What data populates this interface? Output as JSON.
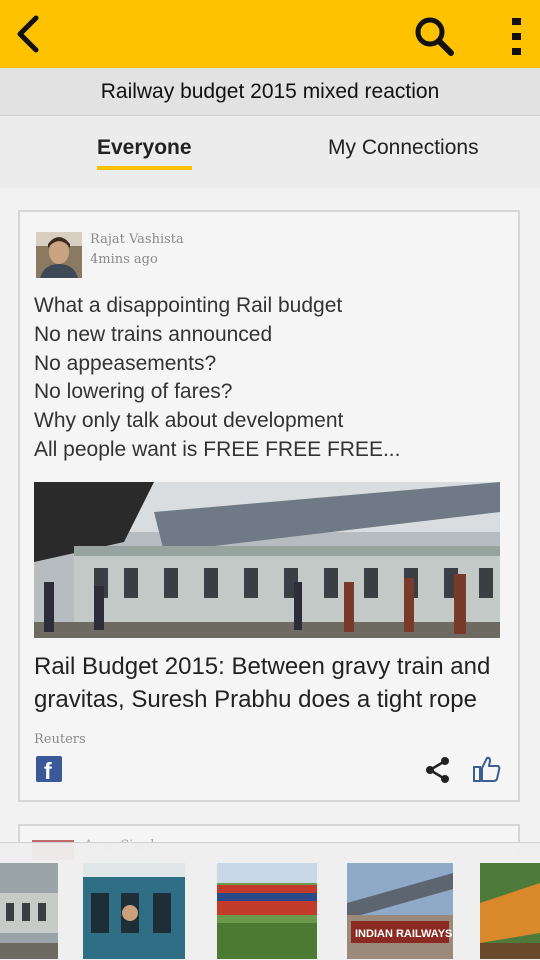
{
  "appbar": {
    "back_icon": "chevron-left-icon",
    "search_icon": "search-icon",
    "more_icon": "more-vertical-icon",
    "color": "#ffc200"
  },
  "topic": {
    "title": "Railway budget 2015 mixed reaction"
  },
  "tabs": [
    {
      "label": "Everyone",
      "active": true
    },
    {
      "label": "My Connections",
      "active": false
    }
  ],
  "post": {
    "author": "Rajat  Vashista",
    "time": "4mins ago",
    "lines": [
      "What a disappointing Rail budget",
      "No new trains announced",
      "No  appeasements?",
      "No lowering of fares?",
      "Why only talk about development",
      "All people want is FREE FREE FREE..."
    ],
    "link": {
      "headline": "Rail Budget 2015: Between gravy train and gravitas, Suresh Prabhu does a tight rope",
      "source": "Reuters"
    },
    "actions": {
      "facebook_icon": "facebook-icon",
      "share_icon": "share-icon",
      "like_icon": "thumbs-up-icon",
      "facebook_letter": "f"
    }
  },
  "next_post": {
    "author": "Arun  Singh"
  },
  "thumbnails": [
    {
      "label": ""
    },
    {
      "label": ""
    },
    {
      "label": ""
    },
    {
      "label": "INDIAN RAILWAYS"
    },
    {
      "label": ""
    }
  ]
}
